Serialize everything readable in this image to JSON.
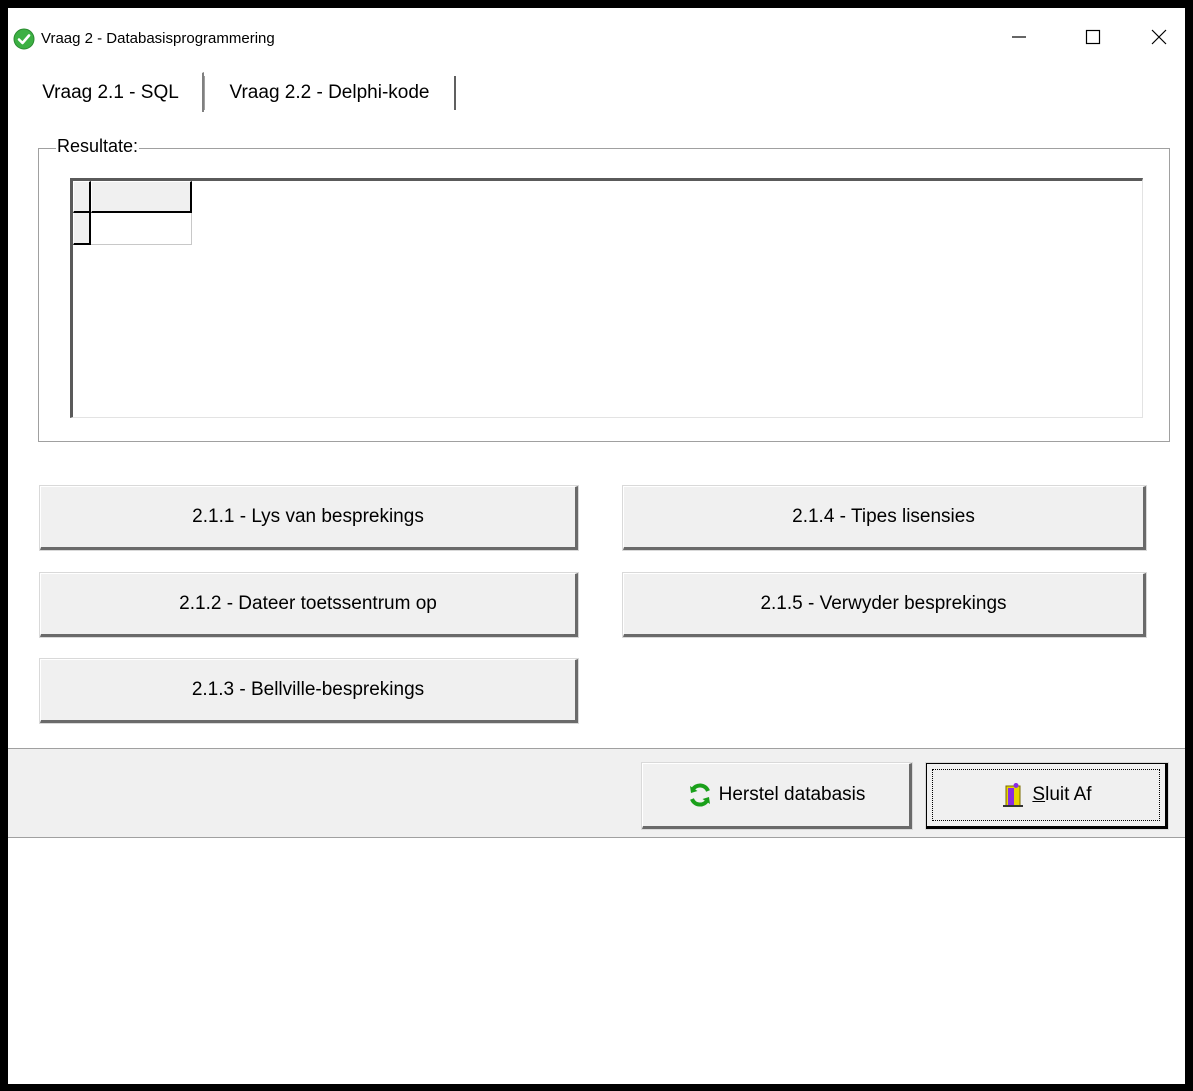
{
  "window": {
    "title": "Vraag 2 - Databasisprogrammering"
  },
  "tabs": [
    {
      "label": "Vraag 2.1 - SQL",
      "active": true
    },
    {
      "label": "Vraag 2.2 - Delphi-kode",
      "active": false
    }
  ],
  "results": {
    "label": "Resultate:"
  },
  "buttons": {
    "b211": "2.1.1 - Lys van besprekings",
    "b212": "2.1.2 - Dateer toetssentrum op",
    "b213": "2.1.3 - Bellville-besprekings",
    "b214": "2.1.4 - Tipes lisensies",
    "b215": "2.1.5 - Verwyder besprekings"
  },
  "footer": {
    "restore_label": "Herstel databasis",
    "close_label": "Sluit Af"
  },
  "icons": {
    "app": "check-circle-icon",
    "restore": "refresh-icon",
    "close": "exit-door-icon"
  },
  "colors": {
    "app_icon": "#3cb043",
    "refresh_icon": "#1aa01a",
    "exit_icon": "#8a2be2"
  }
}
